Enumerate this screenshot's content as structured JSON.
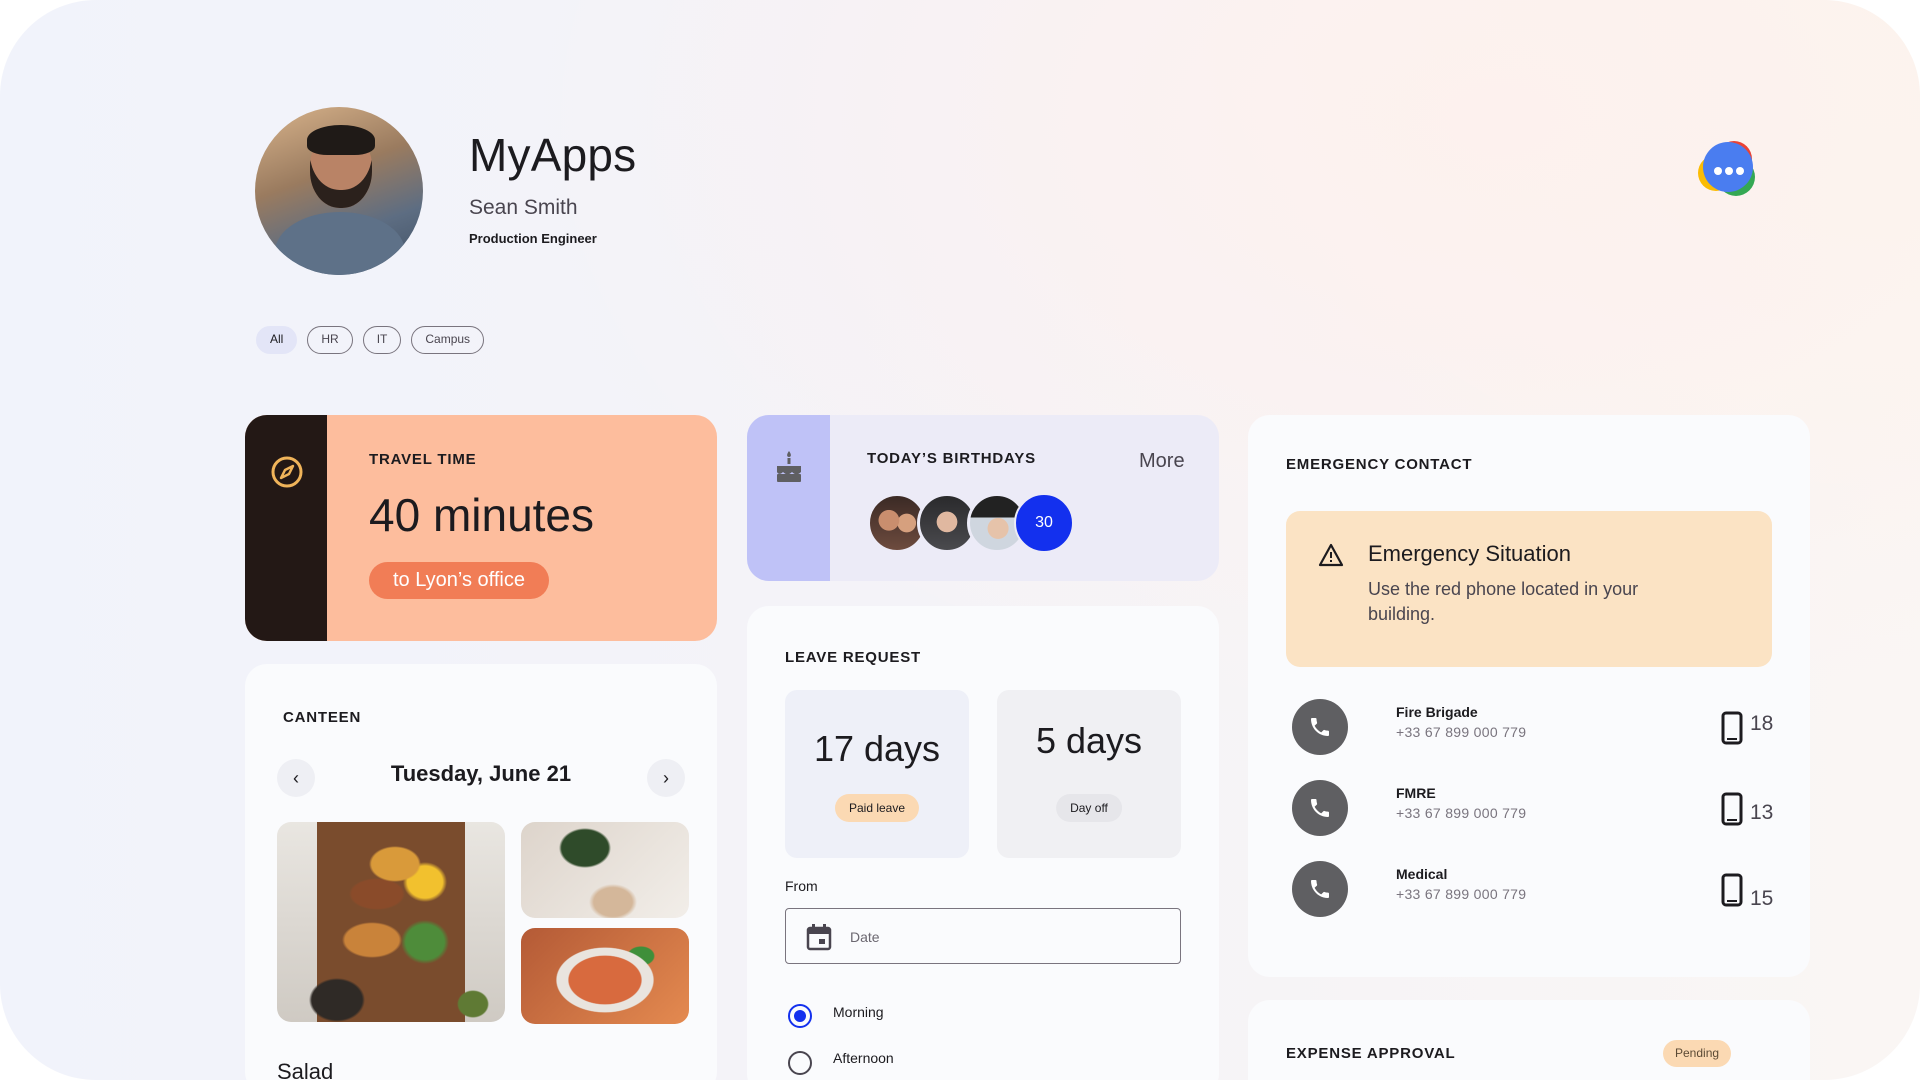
{
  "header": {
    "app_title": "MyApps",
    "user_name": "Sean Smith",
    "user_role": "Production Engineer",
    "avatar_icon": "user-avatar",
    "chat_icon": "chat-bubble-icon"
  },
  "filters": [
    "All",
    "HR",
    "IT",
    "Campus"
  ],
  "travel": {
    "title": "TRAVEL TIME",
    "value": "40 minutes",
    "destination": "to Lyon’s office",
    "icon": "compass-icon",
    "accent": "#fdbd9d"
  },
  "birthdays": {
    "title": "TODAY’S BIRTHDAYS",
    "more_label": "More",
    "count": "30",
    "icon": "cake-icon"
  },
  "emergency": {
    "title": "EMERGENCY CONTACT",
    "alert_title": "Emergency Situation",
    "alert_message": "Use the red phone located in your building.",
    "contacts": [
      {
        "name": "Fire Brigade",
        "number": "+33 67 899 000 779",
        "short": "18"
      },
      {
        "name": "FMRE",
        "number": "+33 67 899 000 779",
        "short": "13"
      },
      {
        "name": "Medical",
        "number": "+33 67 899 000 779",
        "short": "15"
      }
    ]
  },
  "canteen": {
    "title": "CANTEEN",
    "date": "Tuesday, June 21",
    "prev_icon": "chevron-left-icon",
    "next_icon": "chevron-right-icon",
    "dish": "Salad"
  },
  "leave": {
    "title": "LEAVE REQUEST",
    "paid_days": "17 days",
    "paid_label": "Paid leave",
    "off_days": "5 days",
    "off_label": "Day off",
    "from_label": "From",
    "date_placeholder": "Date",
    "options": [
      "Morning",
      "Afternoon"
    ],
    "selected": "Morning"
  },
  "expense": {
    "title": "EXPENSE APPROVAL",
    "status": "Pending"
  }
}
